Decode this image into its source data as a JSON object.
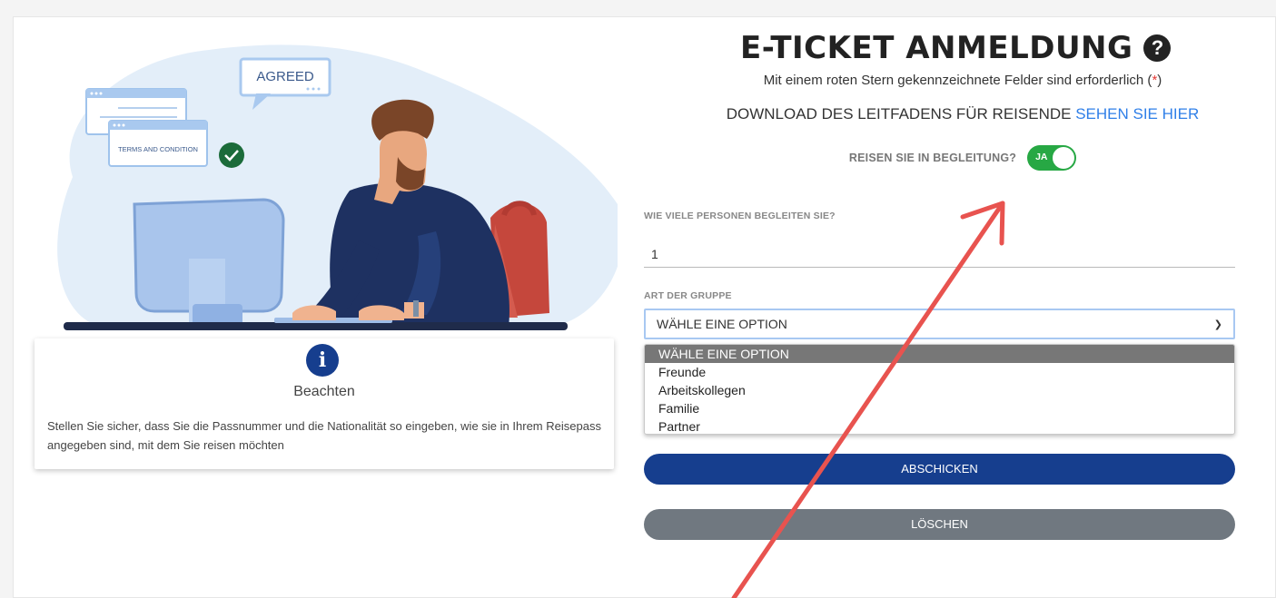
{
  "illustration": {
    "speech_bubble": "AGREED",
    "terms_card": "TERMS AND CONDITION"
  },
  "notice": {
    "icon": "info-icon",
    "title": "Beachten",
    "text": "Stellen Sie sicher, dass Sie die Passnummer und die Nationalität so eingeben, wie sie in Ihrem Reisepass angegeben sind, mit dem Sie reisen möchten"
  },
  "form": {
    "title": "E-TICKET ANMELDUNG",
    "help_icon": "question-circle-icon",
    "required_note": "Mit einem roten Stern gekennzeichnete Felder sind erforderlich (",
    "required_star": "*",
    "required_note_end": ")",
    "download_text": "DOWNLOAD DES LEITFADENS FÜR REISENDE",
    "download_link": "SEHEN SIE HIER",
    "companion_label": "REISEN SIE IN BEGLEITUNG?",
    "companion_toggle": "JA",
    "companion_enabled": true,
    "persons_label": "WIE VIELE PERSONEN BEGLEITEN SIE?",
    "persons_value": "1",
    "group_label": "ART DER GRUPPE",
    "group_selected": "WÄHLE EINE OPTION",
    "group_options": [
      "WÄHLE EINE OPTION",
      "Freunde",
      "Arbeitskollegen",
      "Familie",
      "Partner"
    ],
    "submit_label": "ABSCHICKEN",
    "clear_label": "LÖSCHEN"
  },
  "colors": {
    "primary": "#163e8e",
    "toggle_on": "#27a844",
    "link": "#2f7fe8",
    "required_star": "#e53935",
    "annotation_arrow": "#e8534f",
    "clear_button": "#707880"
  }
}
